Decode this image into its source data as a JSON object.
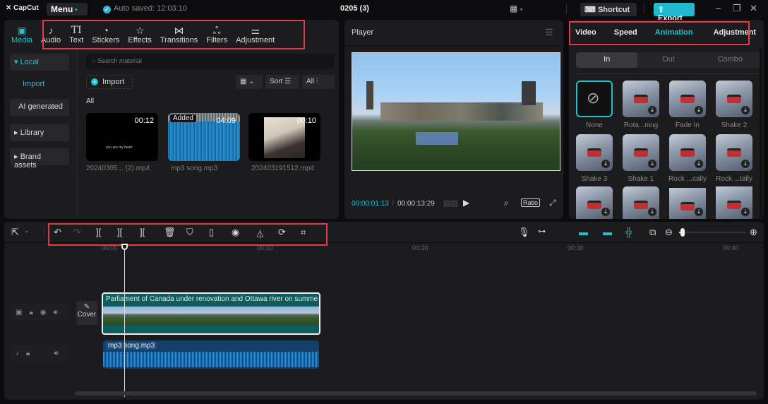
{
  "titlebar": {
    "app_name": "CapCut",
    "menu_label": "Menu",
    "autosave": "Auto saved: 12:03:10",
    "project_title": "0205 (3)",
    "shortcut_label": "Shortcut",
    "export_label": "Export",
    "window_controls": [
      "minimize",
      "restore",
      "close"
    ]
  },
  "media_toolbar": {
    "tabs": [
      {
        "label": "Media",
        "icon": "media-icon",
        "active": true
      },
      {
        "label": "Audio",
        "icon": "audio-icon"
      },
      {
        "label": "Text",
        "icon": "text-icon"
      },
      {
        "label": "Stickers",
        "icon": "stickers-icon"
      },
      {
        "label": "Effects",
        "icon": "effects-icon"
      },
      {
        "label": "Transitions",
        "icon": "transitions-icon"
      },
      {
        "label": "Filters",
        "icon": "filters-icon"
      },
      {
        "label": "Adjustment",
        "icon": "adjustment-icon"
      }
    ]
  },
  "media_sidebar": {
    "items": [
      {
        "label": "▾ Local"
      },
      {
        "label": "Import"
      },
      {
        "label": "AI generated"
      },
      {
        "label": "▸ Library"
      },
      {
        "label": "▸ Brand assets"
      }
    ]
  },
  "media_main": {
    "search_placeholder": "Search material",
    "import_label": "Import",
    "sort_label": "Sort",
    "filter_label": "All",
    "section_label": "All",
    "items": [
      {
        "name": "20240305... (2).mp4",
        "duration": "00:12",
        "caption": "you are my heart"
      },
      {
        "name": "mp3 song.mp3",
        "duration": "04:09",
        "badge": "Added"
      },
      {
        "name": "202403191512.mp4",
        "duration": "00:10"
      }
    ]
  },
  "player": {
    "title": "Player",
    "current_time": "00:00:01:13",
    "total_time": "00:00:13:29",
    "ratio_label": "Ratio"
  },
  "right_panel": {
    "tabs": [
      {
        "label": "Video"
      },
      {
        "label": "Speed"
      },
      {
        "label": "Animation",
        "active": true
      },
      {
        "label": "Adjustment"
      }
    ],
    "segments": [
      {
        "label": "In",
        "active": true
      },
      {
        "label": "Out"
      },
      {
        "label": "Combo"
      }
    ],
    "animations": [
      {
        "label": "None",
        "selected": true
      },
      {
        "label": "Rota...ning"
      },
      {
        "label": "Fade In"
      },
      {
        "label": "Shake 2"
      },
      {
        "label": "Shake 3"
      },
      {
        "label": "Shake 1"
      },
      {
        "label": "Rock ...cally"
      },
      {
        "label": "Rock ...tally"
      },
      {
        "label": ""
      },
      {
        "label": ""
      },
      {
        "label": ""
      },
      {
        "label": ""
      }
    ]
  },
  "timeline": {
    "ruler_labels": [
      "00:00",
      "00:10",
      "00:20",
      "00:30",
      "00:40"
    ],
    "video_clip_label": "Parliament of Canada under renovation and Ottawa river on summe",
    "audio_clip_label": "mp3 song.mp3",
    "cover_label": "Cover",
    "zoom_level": 0.05
  },
  "colors": {
    "accent": "#22c1d0",
    "highlight_box": "#e43946",
    "video_clip": "#0f5c5a",
    "audio_clip": "#16406a"
  }
}
